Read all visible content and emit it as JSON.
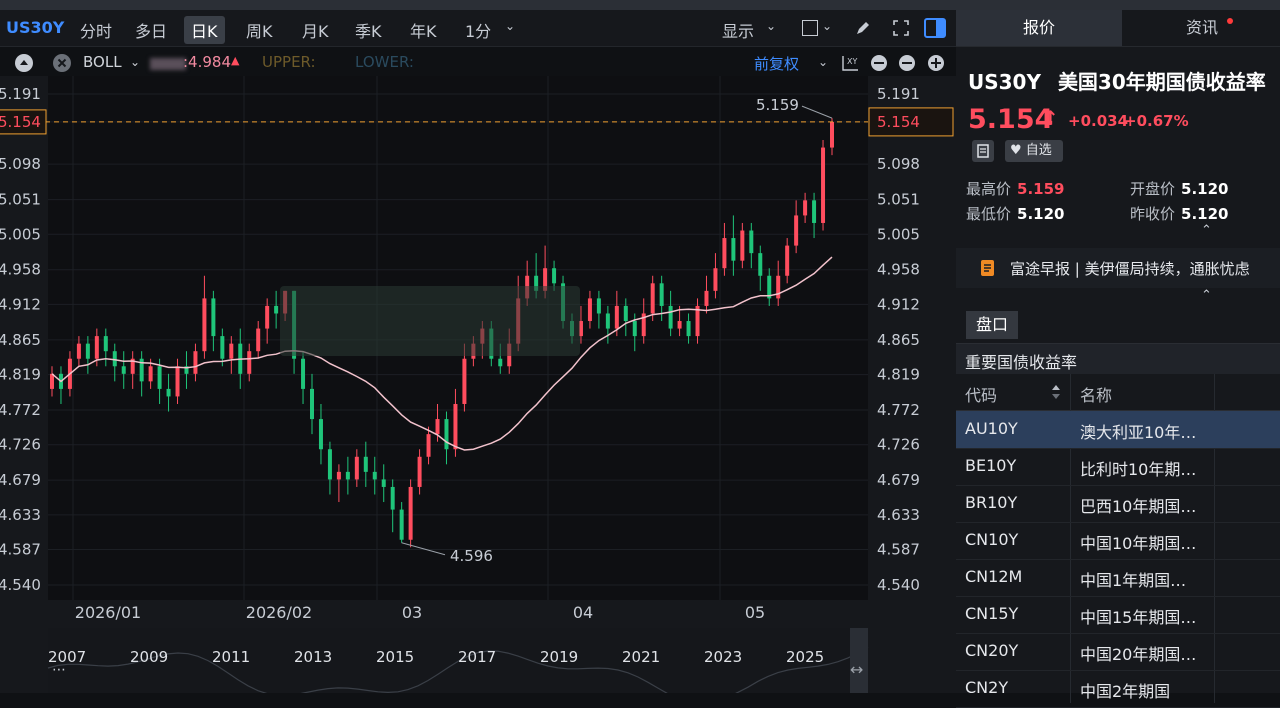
{
  "toolbar": {
    "symbol": "US30Y",
    "periods": [
      "分时",
      "多日",
      "日K",
      "周K",
      "月K",
      "季K",
      "年K",
      "1分"
    ],
    "active_period": "日K",
    "display_label": "显示",
    "adjust_label": "前复权"
  },
  "indicator": {
    "name": "BOLL",
    "mid_value": ":4.984",
    "upper_label": "UPPER:",
    "lower_label": "LOWER:"
  },
  "chart_data": {
    "type": "candlestick",
    "x_labels": [
      "2026/01",
      "2026/02",
      "03",
      "04",
      "05"
    ],
    "y_ticks": [
      "5.191",
      "5.154",
      "5.098",
      "5.051",
      "5.005",
      "4.958",
      "4.912",
      "4.865",
      "4.819",
      "4.772",
      "4.726",
      "4.679",
      "4.633",
      "4.587",
      "4.540"
    ],
    "ylim": [
      4.54,
      5.191
    ],
    "current_price_label": "5.154",
    "high_annotation": "5.159",
    "low_annotation": "4.596",
    "overview_years": [
      "2007",
      "2009",
      "2011",
      "2013",
      "2015",
      "2017",
      "2019",
      "2021",
      "2023",
      "2025"
    ],
    "colors": {
      "up": "#ff4d5e",
      "down": "#1fc57a",
      "ma": "#f2c2cc",
      "price_line": "#f0a030"
    },
    "candles": [
      [
        4.8,
        4.82,
        4.79,
        4.83
      ],
      [
        4.82,
        4.8,
        4.78,
        4.83
      ],
      [
        4.8,
        4.84,
        4.79,
        4.85
      ],
      [
        4.84,
        4.86,
        4.83,
        4.87
      ],
      [
        4.86,
        4.84,
        4.82,
        4.87
      ],
      [
        4.84,
        4.87,
        4.83,
        4.88
      ],
      [
        4.87,
        4.85,
        4.83,
        4.88
      ],
      [
        4.85,
        4.83,
        4.81,
        4.86
      ],
      [
        4.83,
        4.82,
        4.8,
        4.85
      ],
      [
        4.82,
        4.84,
        4.8,
        4.85
      ],
      [
        4.84,
        4.81,
        4.79,
        4.85
      ],
      [
        4.81,
        4.83,
        4.8,
        4.84
      ],
      [
        4.83,
        4.8,
        4.78,
        4.84
      ],
      [
        4.8,
        4.79,
        4.77,
        4.82
      ],
      [
        4.79,
        4.83,
        4.78,
        4.84
      ],
      [
        4.83,
        4.82,
        4.8,
        4.85
      ],
      [
        4.82,
        4.85,
        4.81,
        4.86
      ],
      [
        4.85,
        4.92,
        4.84,
        4.95
      ],
      [
        4.92,
        4.87,
        4.85,
        4.93
      ],
      [
        4.87,
        4.84,
        4.83,
        4.88
      ],
      [
        4.84,
        4.86,
        4.82,
        4.87
      ],
      [
        4.86,
        4.82,
        4.8,
        4.88
      ],
      [
        4.82,
        4.85,
        4.81,
        4.86
      ],
      [
        4.85,
        4.88,
        4.84,
        4.89
      ],
      [
        4.88,
        4.91,
        4.86,
        4.92
      ],
      [
        4.91,
        4.9,
        4.88,
        4.93
      ],
      [
        4.9,
        4.93,
        4.89,
        4.93
      ],
      [
        4.93,
        4.84,
        4.82,
        4.93
      ],
      [
        4.84,
        4.8,
        4.78,
        4.85
      ],
      [
        4.8,
        4.76,
        4.74,
        4.82
      ],
      [
        4.76,
        4.72,
        4.7,
        4.78
      ],
      [
        4.72,
        4.68,
        4.66,
        4.73
      ],
      [
        4.68,
        4.69,
        4.65,
        4.7
      ],
      [
        4.69,
        4.68,
        4.66,
        4.71
      ],
      [
        4.68,
        4.71,
        4.67,
        4.72
      ],
      [
        4.71,
        4.69,
        4.67,
        4.73
      ],
      [
        4.69,
        4.68,
        4.66,
        4.71
      ],
      [
        4.68,
        4.67,
        4.65,
        4.7
      ],
      [
        4.67,
        4.64,
        4.61,
        4.68
      ],
      [
        4.64,
        4.6,
        4.596,
        4.65
      ],
      [
        4.6,
        4.67,
        4.59,
        4.68
      ],
      [
        4.67,
        4.71,
        4.66,
        4.72
      ],
      [
        4.71,
        4.74,
        4.7,
        4.75
      ],
      [
        4.74,
        4.76,
        4.73,
        4.78
      ],
      [
        4.76,
        4.72,
        4.7,
        4.77
      ],
      [
        4.72,
        4.78,
        4.71,
        4.8
      ],
      [
        4.78,
        4.84,
        4.77,
        4.86
      ],
      [
        4.84,
        4.86,
        4.83,
        4.87
      ],
      [
        4.86,
        4.88,
        4.84,
        4.89
      ],
      [
        4.88,
        4.84,
        4.83,
        4.89
      ],
      [
        4.84,
        4.83,
        4.82,
        4.86
      ],
      [
        4.83,
        4.86,
        4.82,
        4.88
      ],
      [
        4.86,
        4.92,
        4.85,
        4.95
      ],
      [
        4.92,
        4.95,
        4.91,
        4.97
      ],
      [
        4.95,
        4.93,
        4.92,
        4.98
      ],
      [
        4.93,
        4.96,
        4.92,
        4.99
      ],
      [
        4.96,
        4.94,
        4.93,
        4.97
      ],
      [
        4.94,
        4.89,
        4.88,
        4.95
      ],
      [
        4.89,
        4.87,
        4.86,
        4.9
      ],
      [
        4.87,
        4.89,
        4.86,
        4.91
      ],
      [
        4.89,
        4.92,
        4.88,
        4.93
      ],
      [
        4.92,
        4.9,
        4.88,
        4.93
      ],
      [
        4.9,
        4.88,
        4.86,
        4.91
      ],
      [
        4.88,
        4.91,
        4.87,
        4.93
      ],
      [
        4.91,
        4.89,
        4.87,
        4.92
      ],
      [
        4.89,
        4.87,
        4.85,
        4.9
      ],
      [
        4.87,
        4.9,
        4.86,
        4.92
      ],
      [
        4.9,
        4.94,
        4.89,
        4.95
      ],
      [
        4.94,
        4.91,
        4.89,
        4.95
      ],
      [
        4.91,
        4.88,
        4.87,
        4.93
      ],
      [
        4.88,
        4.89,
        4.87,
        4.91
      ],
      [
        4.89,
        4.87,
        4.86,
        4.9
      ],
      [
        4.87,
        4.91,
        4.86,
        4.92
      ],
      [
        4.91,
        4.93,
        4.9,
        4.95
      ],
      [
        4.93,
        4.96,
        4.92,
        4.98
      ],
      [
        4.96,
        5.0,
        4.95,
        5.02
      ],
      [
        5.0,
        4.97,
        4.95,
        5.03
      ],
      [
        4.97,
        5.01,
        4.96,
        5.02
      ],
      [
        5.01,
        4.98,
        4.96,
        5.02
      ],
      [
        4.98,
        4.95,
        4.93,
        4.99
      ],
      [
        4.95,
        4.92,
        4.91,
        4.96
      ],
      [
        4.92,
        4.95,
        4.91,
        4.97
      ],
      [
        4.95,
        4.99,
        4.94,
        5.0
      ],
      [
        4.99,
        5.03,
        4.98,
        5.05
      ],
      [
        5.03,
        5.05,
        5.02,
        5.06
      ],
      [
        5.05,
        5.02,
        5.0,
        5.06
      ],
      [
        5.02,
        5.12,
        5.01,
        5.13
      ],
      [
        5.12,
        5.154,
        5.11,
        5.159
      ]
    ]
  },
  "quote": {
    "symbol": "US30Y",
    "name": "美国30年期国债收益率",
    "price": "5.154",
    "arrow": "↑",
    "change": "+0.034",
    "change_pct": "+0.67%",
    "watch_label": "自选",
    "high_label": "最高价",
    "high_value": "5.159",
    "open_label": "开盘价",
    "open_value": "5.120",
    "low_label": "最低价",
    "low_value": "5.120",
    "prev_label": "昨收价",
    "prev_value": "5.120"
  },
  "tabs": {
    "quote": "报价",
    "news": "资讯"
  },
  "news": {
    "text": "富途早报 | 美伊僵局持续，通胀忧虑"
  },
  "orderbook": {
    "label": "盘口"
  },
  "bond_table": {
    "title": "重要国债收益率",
    "col_code": "代码",
    "col_name": "名称",
    "rows": [
      {
        "code": "AU10Y",
        "name": "澳大利亚10年…"
      },
      {
        "code": "BE10Y",
        "name": "比利时10年期…"
      },
      {
        "code": "BR10Y",
        "name": "巴西10年期国…"
      },
      {
        "code": "CN10Y",
        "name": "中国10年期国…"
      },
      {
        "code": "CN12M",
        "name": "中国1年期国…"
      },
      {
        "code": "CN15Y",
        "name": "中国15年期国…"
      },
      {
        "code": "CN20Y",
        "name": "中国20年期国…"
      },
      {
        "code": "CN2Y",
        "name": "中国2年期国"
      }
    ]
  }
}
